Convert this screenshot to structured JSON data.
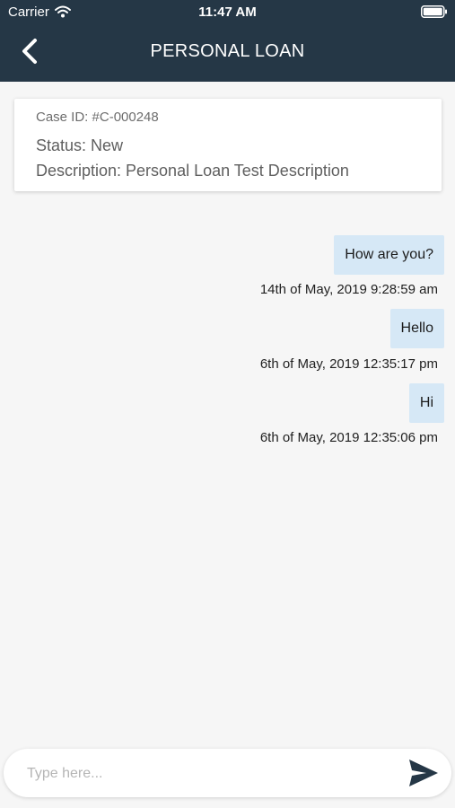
{
  "status_bar": {
    "carrier": "Carrier",
    "time": "11:47 AM",
    "icons": [
      "wifi-icon",
      "battery-icon"
    ]
  },
  "header": {
    "title": "PERSONAL LOAN",
    "back_icon": "chevron-left-icon",
    "background": "#253746"
  },
  "case": {
    "id": "Case ID: #C-000248",
    "status": "Status: New",
    "description": "Description: Personal Loan Test Description"
  },
  "messages": [
    {
      "text": "How are you?",
      "timestamp": "14th of May, 2019 9:28:59 am"
    },
    {
      "text": "Hello",
      "timestamp": "6th of May, 2019 12:35:17 pm"
    },
    {
      "text": "Hi",
      "timestamp": "6th of May, 2019 12:35:06 pm"
    }
  ],
  "composer": {
    "placeholder": "Type here...",
    "value": "",
    "send_icon": "send-icon"
  },
  "colors": {
    "bubble": "#d6e8f6",
    "background": "#f6f6f6"
  }
}
